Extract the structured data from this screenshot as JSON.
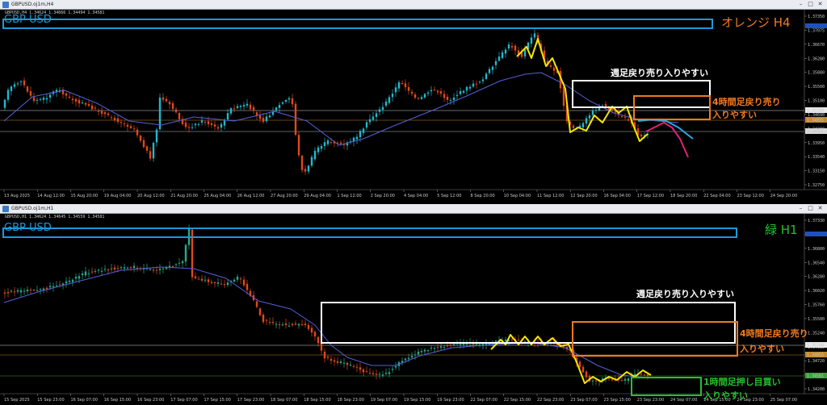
{
  "top": {
    "window_title": "GBPUSD.oj1m,H4",
    "ohlc": "GBPUSD,H4  1.34624 1.34666 1.34494 1.34581",
    "symbol_label": "GBP USD",
    "timeframe_label": "オレンジ H4",
    "note_weekly": "週足戻り売り入りやすい",
    "note_4h_line1": "4時間足戻り売り",
    "note_4h_line2": "入りやすい",
    "prices": [
      "1.37350",
      "1.37075",
      "1.36670",
      "1.36280",
      "1.35880",
      "1.35500",
      "1.35100",
      "1.34690",
      "1.34300",
      "1.33950",
      "1.33540",
      "1.33150",
      "1.32750"
    ],
    "price_tags": {
      "white": "1.35100",
      "orange": "1.34855",
      "white2": "1.34581"
    },
    "times": [
      "13 Aug 2025",
      "14 Aug 12:00",
      "15 Aug 20:00",
      "19 Aug 04:00",
      "20 Aug 12:00",
      "21 Aug 20:00",
      "25 Aug 04:00",
      "26 Aug 12:00",
      "27 Aug 20:00",
      "29 Aug 04:00",
      "1 Sep 12:00",
      "2 Sep 20:00",
      "4 Sep 04:00",
      "5 Sep 12:00",
      "8 Sep 20:00",
      "10 Sep 04:00",
      "11 Sep 12:00",
      "12 Sep 20:00",
      "16 Sep 04:00",
      "17 Sep 12:00",
      "18 Sep 20:00",
      "22 Sep 04:00",
      "23 Sep 12:00",
      "24 Sep 20:00"
    ],
    "colors": {
      "up": "#22b8cc",
      "down": "#e0481c",
      "ma": "#5560d8",
      "zigzag": "#f4e600",
      "proj1": "#2ba8e8",
      "proj2": "#e0207a",
      "weekly": "#ffffff",
      "h4": "#f07a20",
      "symbox": "#1e98d8"
    }
  },
  "bottom": {
    "window_title": "GBPUSD.oj1m,H1",
    "ohlc": "GBPUSD,H1  1.34624 1.34645 1.34559 1.34581",
    "symbol_label": "GBP USD",
    "timeframe_label": "緑 H1",
    "note_weekly": "週足戻り売り入りやすい",
    "note_4h_line1": "4時間足戻り売り",
    "note_4h_line2": "入りやすい",
    "note_1h_line1": "1時間足押し目買い",
    "note_1h_line2": "入りやすい",
    "prices": [
      "1.37330",
      "1.37075",
      "1.36800",
      "1.36540",
      "1.36280",
      "1.36020",
      "1.35760",
      "1.35500",
      "1.35240",
      "1.34980",
      "1.34720",
      "1.34460",
      "1.34200"
    ],
    "price_tags": {
      "white": "1.35100",
      "orange": "1.34855",
      "green": "1.34581"
    },
    "times": [
      "15 Sep 2025",
      "15 Sep 23:00",
      "16 Sep 07:00",
      "16 Sep 15:00",
      "16 Sep 23:00",
      "17 Sep 07:00",
      "17 Sep 15:00",
      "17 Sep 23:00",
      "18 Sep 07:00",
      "18 Sep 15:00",
      "18 Sep 23:00",
      "19 Sep 07:00",
      "19 Sep 15:00",
      "19 Sep 23:00",
      "22 Sep 07:00",
      "22 Sep 15:00",
      "22 Sep 23:00",
      "23 Sep 07:00",
      "23 Sep 15:00",
      "23 Sep 23:00",
      "24 Sep 07:00",
      "24 Sep 15:00",
      "24 Sep 23:00",
      "25 Sep 07:00"
    ],
    "colors": {
      "up": "#2aa88c",
      "down": "#e0481c",
      "ma": "#5560d8",
      "zigzag": "#f4e600",
      "weekly": "#ffffff",
      "h4": "#f07a20",
      "h1": "#26c030",
      "symbox": "#1e98d8"
    }
  }
}
